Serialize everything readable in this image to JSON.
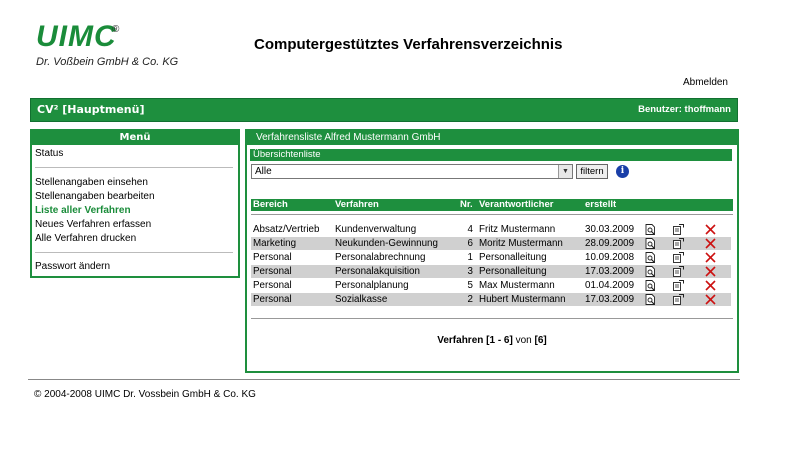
{
  "header": {
    "logo": "UIMC",
    "logo_reg": "®",
    "logo_sub": "Dr. Voßbein GmbH & Co. KG",
    "title": "Computergestütztes Verfahrensverzeichnis",
    "logout": "Abmelden"
  },
  "topbar": {
    "left": "CV² [Hauptmenü]",
    "user": "Benutzer: thoffmann"
  },
  "menu": {
    "title": "Menü",
    "items": [
      "Status",
      "Stellenangaben einsehen",
      "Stellenangaben bearbeiten",
      "Liste aller Verfahren",
      "Neues Verfahren erfassen",
      "Alle Verfahren drucken",
      "Passwort ändern"
    ]
  },
  "panel": {
    "title": "Verfahrensliste  Alfred Mustermann GmbH",
    "subtitle": "Übersichtenliste",
    "filter_value": "Alle",
    "filter_button": "filtern",
    "columns": [
      "Bereich",
      "Verfahren",
      "Nr.",
      "Verantwortlicher",
      "erstellt"
    ],
    "rows": [
      [
        "Absatz/Vertrieb",
        "Kundenverwaltung",
        "4",
        "Fritz Mustermann",
        "30.03.2009"
      ],
      [
        "Marketing",
        "Neukunden-Gewinnung",
        "6",
        "Moritz Mustermann",
        "28.09.2009"
      ],
      [
        "Personal",
        "Personalabrechnung",
        "1",
        "Personalleitung",
        "10.09.2008"
      ],
      [
        "Personal",
        "Personalakquisition",
        "3",
        "Personalleitung",
        "17.03.2009"
      ],
      [
        "Personal",
        "Personalplanung",
        "5",
        "Max Mustermann",
        "01.04.2009"
      ],
      [
        "Personal",
        "Sozialkasse",
        "2",
        "Hubert Mustermann",
        "17.03.2009"
      ]
    ],
    "pager_label": "Verfahren",
    "pager_range": "[1 - 6]",
    "pager_of": "von",
    "pager_total": "[6]"
  },
  "footer": {
    "copyright": "© 2004-2008 UIMC Dr. Vossbein GmbH & Co. KG"
  },
  "colors": {
    "brand_green": "#1e8f3e",
    "delete_red": "#cc1111",
    "info_blue": "#1a3fa8"
  },
  "icons": [
    "view-icon",
    "edit-icon",
    "delete-icon",
    "info-icon",
    "chevron-down-icon"
  ]
}
